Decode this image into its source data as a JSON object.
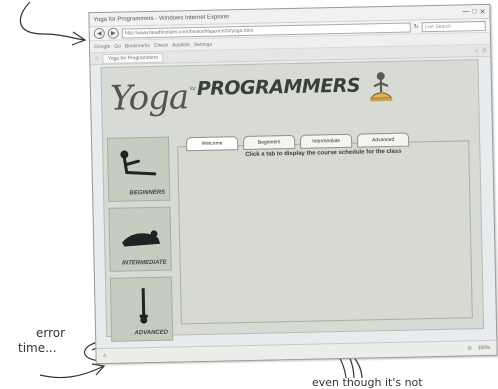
{
  "browser": {
    "title": "Yoga for Programmers - Windows Internet Explorer",
    "address": "http://www.headfirstlabs.com/books/hfajax/ch04/yoga.html",
    "search_placeholder": "Live Search",
    "toolbar": [
      "Google",
      "Go",
      "Bookmarks",
      "Check",
      "Autolink",
      "Settings"
    ],
    "tab_label": "Yoga for Programmers",
    "status_right": "100%"
  },
  "page": {
    "brand_logo": "Yoga",
    "brand_small": "for",
    "brand_title": "PROGRAMMERS",
    "sidebar": [
      {
        "label": "BEGINNERS"
      },
      {
        "label": "INTERMEDIATE"
      },
      {
        "label": "ADVANCED"
      }
    ],
    "tabs": [
      "Welcome",
      "Beginners",
      "Intermediate",
      "Advanced"
    ],
    "message": "Click a tab to display the course schedule for the class"
  },
  "annotations": {
    "error_line1": "error",
    "error_line2": "time...",
    "bottom": "even though it's not"
  }
}
